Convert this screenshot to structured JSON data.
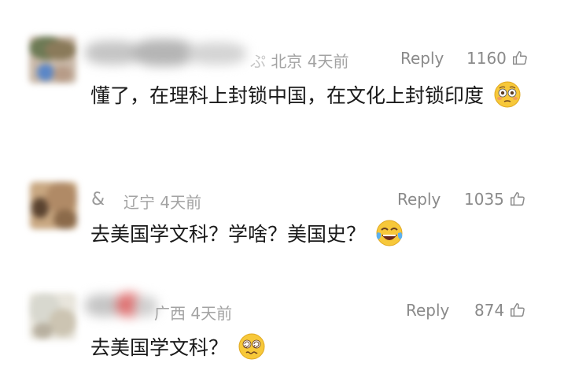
{
  "comments": [
    {
      "location": "北京",
      "time": "4天前",
      "reply_label": "Reply",
      "likes": "1160",
      "text": "懂了，在理科上封锁中国，在文化上封锁印度",
      "emoji": "flushed-face-emoji",
      "avatar_colors": [
        "#6d7a55",
        "#b79c88",
        "#5b87c7",
        "#c9b8a8"
      ]
    },
    {
      "name_visible": "&",
      "location": "辽宁",
      "time": "4天前",
      "reply_label": "Reply",
      "likes": "1035",
      "text": "去美国学文科？学啥？美国史？",
      "emoji": "tears-of-joy-emoji",
      "avatar_colors": [
        "#8b6a4a",
        "#c8a781",
        "#5a4330"
      ]
    },
    {
      "location": "广西",
      "time": "4天前",
      "reply_label": "Reply",
      "likes": "874",
      "text": "去美国学文科？",
      "emoji": "dizzy-face-emoji",
      "avatar_colors": [
        "#d8d8cf",
        "#e8e5dc",
        "#b8b0a0"
      ]
    }
  ],
  "icons": {
    "like": "thumbs-up-outline-icon"
  },
  "colors": {
    "meta": "#a3a3a3",
    "text": "#1a1a1a",
    "reply": "#8a8a8a"
  }
}
